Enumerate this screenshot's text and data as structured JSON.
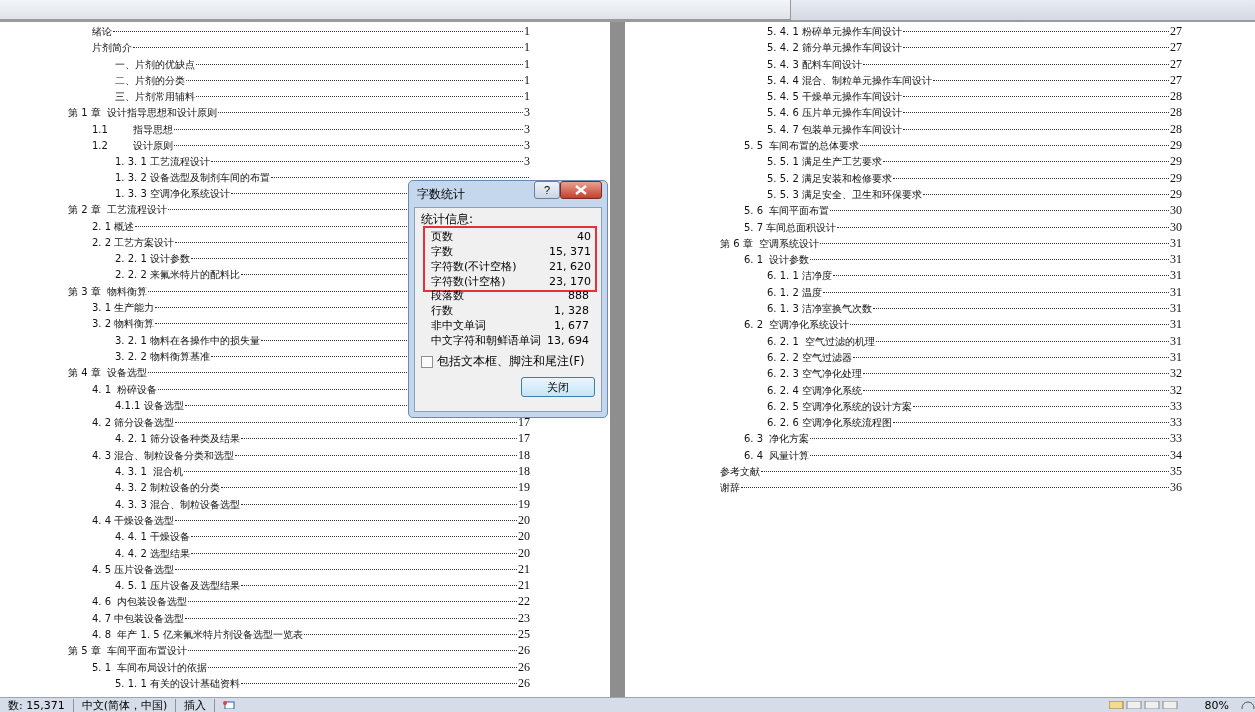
{
  "toc_left": [
    {
      "kind": "section",
      "label": "绪论",
      "page": "1"
    },
    {
      "kind": "section",
      "label": "片剂简介",
      "page": "1"
    },
    {
      "kind": "subsection",
      "label": "一、片剂的优缺点",
      "page": "1"
    },
    {
      "kind": "subsection",
      "label": "二、片剂的分类",
      "page": "1"
    },
    {
      "kind": "subsection",
      "label": "三、片剂常用辅料",
      "page": "1"
    },
    {
      "kind": "chapter",
      "label": "第 1 章  设计指导思想和设计原则",
      "page": "3"
    },
    {
      "kind": "section",
      "label": "1.1        指导思想",
      "page": "3"
    },
    {
      "kind": "section",
      "label": "1.2        设计原则",
      "page": "3"
    },
    {
      "kind": "subsection",
      "label": "1. 3. 1 工艺流程设计",
      "page": "3"
    },
    {
      "kind": "subsection",
      "label": "1. 3. 2 设备选型及制剂车间的布置"
    },
    {
      "kind": "subsection",
      "label": "1. 3. 3 空调净化系统设计"
    },
    {
      "kind": "chapter",
      "label": "第 2 章  工艺流程设计"
    },
    {
      "kind": "section",
      "label": "2. 1 概述"
    },
    {
      "kind": "section",
      "label": "2. 2 工艺方案设计"
    },
    {
      "kind": "subsection",
      "label": "2. 2. 1 设计参数"
    },
    {
      "kind": "subsection",
      "label": "2. 2. 2 来氟米特片的配料比"
    },
    {
      "kind": "chapter",
      "label": "第 3 章  物料衡算"
    },
    {
      "kind": "section",
      "label": "3. 1 生产能力"
    },
    {
      "kind": "section",
      "label": "3. 2 物料衡算"
    },
    {
      "kind": "subsection",
      "label": "3. 2. 1 物料在各操作中的损失量"
    },
    {
      "kind": "subsection",
      "label": "3. 2. 2 物料衡算基准"
    },
    {
      "kind": "chapter",
      "label": "第 4 章  设备选型"
    },
    {
      "kind": "section",
      "label": "4. 1  粉碎设备"
    },
    {
      "kind": "subsection",
      "label": "4.1.1 设备选型"
    },
    {
      "kind": "section",
      "label": "4. 2 筛分设备选型",
      "page": "17"
    },
    {
      "kind": "subsection",
      "label": "4. 2. 1 筛分设备种类及结果",
      "page": "17"
    },
    {
      "kind": "section",
      "label": "4. 3 混合、制粒设备分类和选型",
      "page": "18"
    },
    {
      "kind": "subsection",
      "label": "4. 3. 1  混合机",
      "page": "18"
    },
    {
      "kind": "subsection",
      "label": "4. 3. 2 制粒设备的分类",
      "page": "19"
    },
    {
      "kind": "subsection",
      "label": "4. 3. 3 混合、制粒设备选型",
      "page": "19"
    },
    {
      "kind": "section",
      "label": "4. 4 干燥设备选型",
      "page": "20"
    },
    {
      "kind": "subsection",
      "label": "4. 4. 1 干燥设备",
      "page": "20"
    },
    {
      "kind": "subsection",
      "label": "4. 4. 2 选型结果",
      "page": "20"
    },
    {
      "kind": "section",
      "label": "4. 5 压片设备选型",
      "page": "21"
    },
    {
      "kind": "subsection",
      "label": "4. 5. 1 压片设备及选型结果",
      "page": "21"
    },
    {
      "kind": "section",
      "label": "4. 6  内包装设备选型",
      "page": "22"
    },
    {
      "kind": "section",
      "label": "4. 7 中包装设备选型",
      "page": "23"
    },
    {
      "kind": "section",
      "label": "4. 8  年产 1. 5 亿来氟米特片剂设备选型一览表",
      "page": "25"
    },
    {
      "kind": "chapter",
      "label": "第 5 章  车间平面布置设计",
      "page": "26"
    },
    {
      "kind": "section",
      "label": "5. 1  车间布局设计的依据",
      "page": "26"
    },
    {
      "kind": "subsection",
      "label": "5. 1. 1 有关的设计基础资料",
      "page": "26"
    }
  ],
  "toc_right": [
    {
      "kind": "subsection",
      "label": "5. 4. 1 粉碎单元操作车间设计",
      "page": "27"
    },
    {
      "kind": "subsection",
      "label": "5. 4. 2 筛分单元操作车间设计",
      "page": "27"
    },
    {
      "kind": "subsection",
      "label": "5. 4. 3 配料车间设计",
      "page": "27"
    },
    {
      "kind": "subsection",
      "label": "5. 4. 4 混合、制粒单元操作车间设计",
      "page": "27"
    },
    {
      "kind": "subsection",
      "label": "5. 4. 5 干燥单元操作车间设计",
      "page": "28"
    },
    {
      "kind": "subsection",
      "label": "5. 4. 6 压片单元操作车间设计",
      "page": "28"
    },
    {
      "kind": "subsection",
      "label": "5. 4. 7 包装单元操作车间设计",
      "page": "28"
    },
    {
      "kind": "section",
      "label": "5. 5  车间布置的总体要求",
      "page": "29"
    },
    {
      "kind": "subsection",
      "label": "5. 5. 1 满足生产工艺要求",
      "page": "29"
    },
    {
      "kind": "subsection",
      "label": "5. 5. 2 满足安装和检修要求",
      "page": "29"
    },
    {
      "kind": "subsection",
      "label": "5. 5. 3 满足安全、卫生和环保要求",
      "page": "29"
    },
    {
      "kind": "section",
      "label": "5. 6  车间平面布置",
      "page": "30"
    },
    {
      "kind": "section",
      "label": "5. 7 车间总面积设计",
      "page": "30"
    },
    {
      "kind": "chapter",
      "label": "第 6 章  空调系统设计",
      "page": "31"
    },
    {
      "kind": "section",
      "label": "6. 1  设计参数",
      "page": "31"
    },
    {
      "kind": "subsection",
      "label": "6. 1. 1 洁净度",
      "page": "31"
    },
    {
      "kind": "subsection",
      "label": "6. 1. 2 温度",
      "page": "31"
    },
    {
      "kind": "subsection",
      "label": "6. 1. 3 洁净室换气次数",
      "page": "31"
    },
    {
      "kind": "section",
      "label": "6. 2  空调净化系统设计",
      "page": "31"
    },
    {
      "kind": "subsection",
      "label": "6. 2. 1  空气过滤的机理",
      "page": "31"
    },
    {
      "kind": "subsection",
      "label": "6. 2. 2 空气过滤器",
      "page": "31"
    },
    {
      "kind": "subsection",
      "label": "6. 2. 3 空气净化处理",
      "page": "32"
    },
    {
      "kind": "subsection",
      "label": "6. 2. 4 空调净化系统",
      "page": "32"
    },
    {
      "kind": "subsection",
      "label": "6. 2. 5 空调净化系统的设计方案",
      "page": "33"
    },
    {
      "kind": "subsection",
      "label": "6. 2. 6 空调净化系统流程图",
      "page": "33"
    },
    {
      "kind": "section",
      "label": "6. 3  净化方案",
      "page": "33"
    },
    {
      "kind": "section",
      "label": "6. 4  风量计算",
      "page": "34"
    },
    {
      "kind": "chapter",
      "label": "参考文献",
      "page": "35"
    },
    {
      "kind": "chapter",
      "label": "谢辞",
      "page": "36"
    }
  ],
  "dialog": {
    "title": "字数统计",
    "help": "?",
    "group_label": "统计信息:",
    "framed_stats": [
      {
        "label": "页数",
        "value": "40"
      },
      {
        "label": "字数",
        "value": "15, 371"
      },
      {
        "label": "字符数(不计空格)",
        "value": "21, 620"
      },
      {
        "label": "字符数(计空格)",
        "value": "23, 170"
      }
    ],
    "other_stats": [
      {
        "label": "段落数",
        "value": "888"
      },
      {
        "label": "行数",
        "value": "1, 328"
      },
      {
        "label": "非中文单词",
        "value": "1, 677"
      },
      {
        "label": "中文字符和朝鲜语单词",
        "value": "13, 694"
      }
    ],
    "checkbox": {
      "label": "包括文本框、脚注和尾注(F)",
      "checked": false
    },
    "button": "关闭"
  },
  "status_bar": {
    "items": [
      "数: 15,371",
      "中文(简体，中国)",
      "插入"
    ],
    "zoom": "80%"
  }
}
